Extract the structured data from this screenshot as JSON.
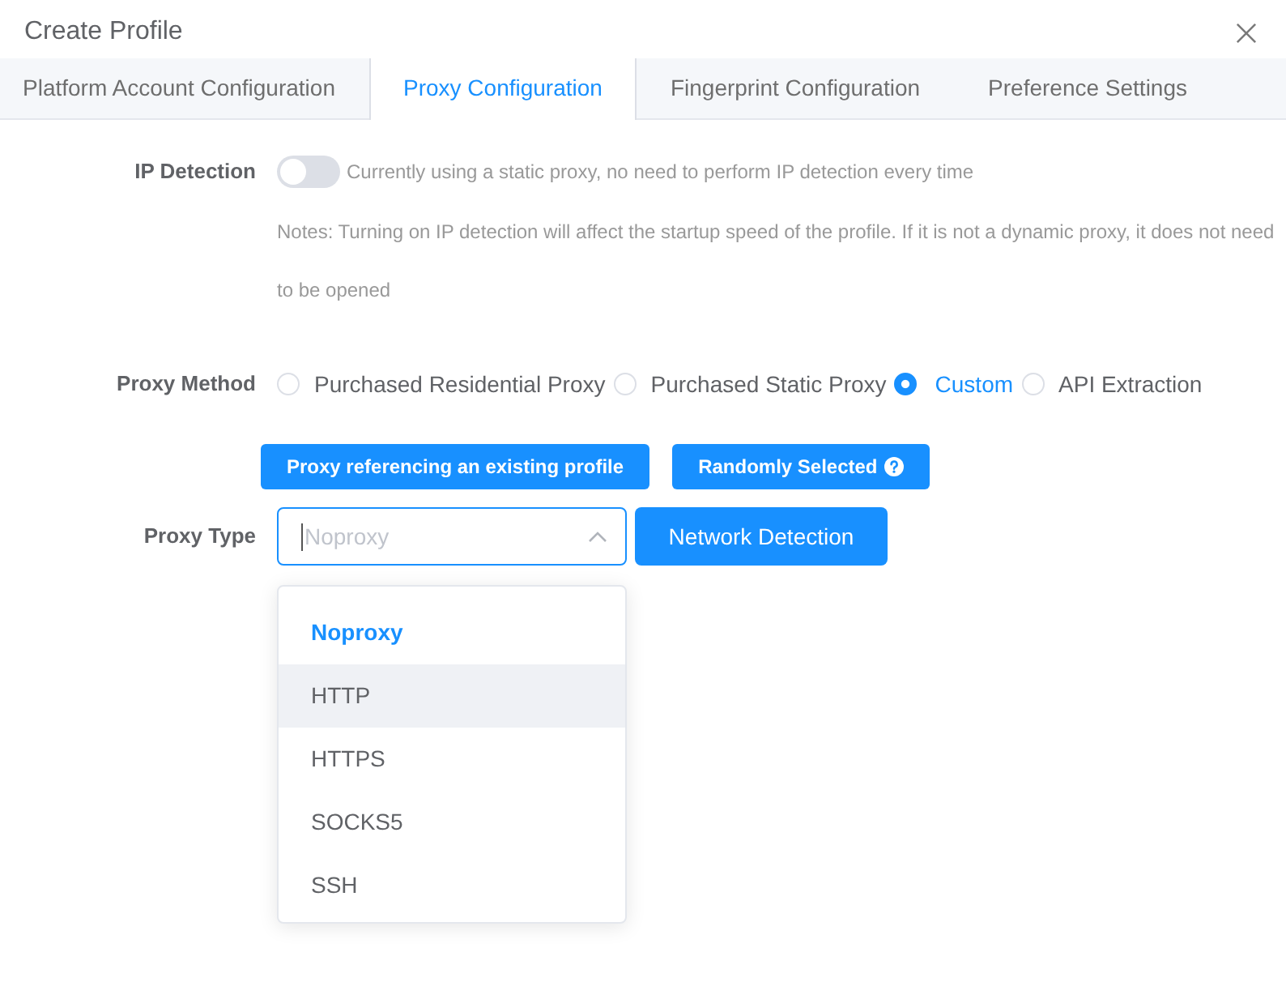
{
  "dialog": {
    "title": "Create Profile"
  },
  "tabs": [
    {
      "label": "Platform Account Configuration",
      "selected": false
    },
    {
      "label": "Proxy Configuration",
      "selected": true
    },
    {
      "label": "Fingerprint Configuration",
      "selected": false
    },
    {
      "label": "Preference Settings",
      "selected": false
    }
  ],
  "ip_detection": {
    "label": "IP Detection",
    "on": false,
    "hint": "Currently using a static proxy, no need to perform IP detection every time",
    "notes": "Notes: Turning on IP detection will affect the startup speed of the profile. If it is not a dynamic proxy, it does not need to be opened"
  },
  "proxy_method": {
    "label": "Proxy Method",
    "options": [
      {
        "label": "Purchased Residential Proxy",
        "selected": false
      },
      {
        "label": "Purchased Static Proxy",
        "selected": false
      },
      {
        "label": "Custom",
        "selected": true
      },
      {
        "label": "API Extraction",
        "selected": false
      }
    ]
  },
  "actions": [
    {
      "label": "Proxy referencing an existing profile",
      "help": false
    },
    {
      "label": "Randomly Selected",
      "help": true
    }
  ],
  "proxy_type": {
    "label": "Proxy Type",
    "placeholder": "Noproxy",
    "expanded": true,
    "button": "Network Detection",
    "options": [
      {
        "label": "Noproxy",
        "selected": true,
        "hovered": false
      },
      {
        "label": "HTTP",
        "selected": false,
        "hovered": true
      },
      {
        "label": "HTTPS",
        "selected": false,
        "hovered": false
      },
      {
        "label": "SOCKS5",
        "selected": false,
        "hovered": false
      },
      {
        "label": "SSH",
        "selected": false,
        "hovered": false
      }
    ]
  }
}
